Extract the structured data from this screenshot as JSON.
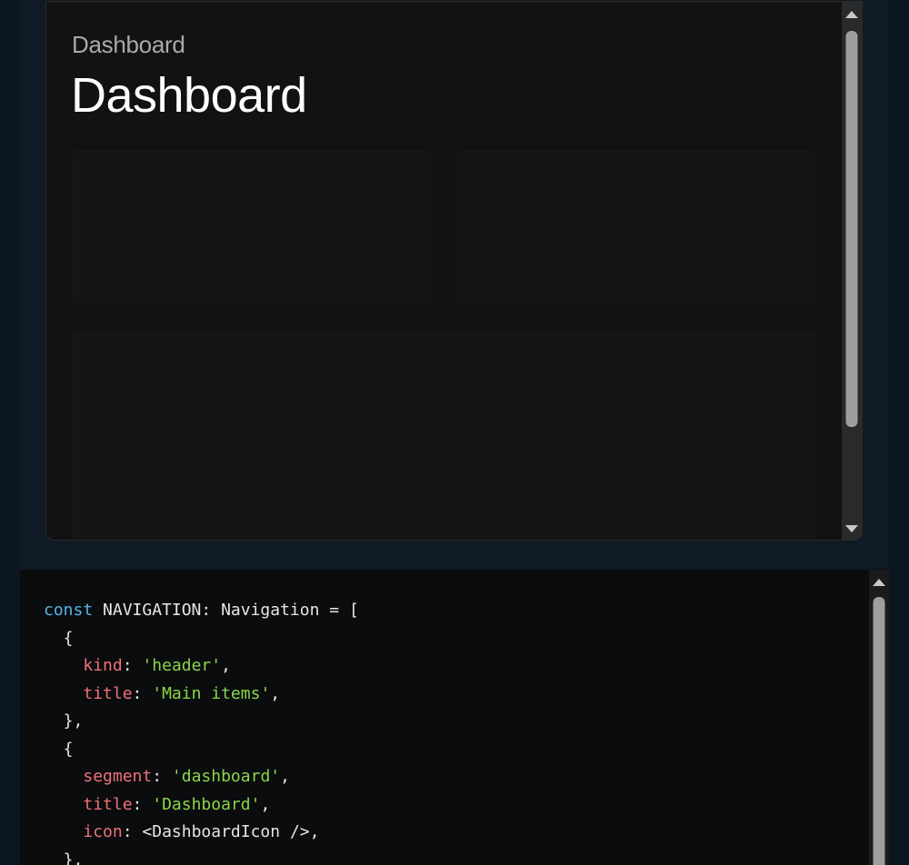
{
  "preview": {
    "breadcrumb": "Dashboard",
    "title": "Dashboard"
  },
  "code": {
    "lines": [
      [
        {
          "t": "kw",
          "v": "const"
        },
        {
          "t": "plain",
          "v": " NAVIGATION: Navigation = ["
        }
      ],
      [
        {
          "t": "plain",
          "v": "  {"
        }
      ],
      [
        {
          "t": "plain",
          "v": "    "
        },
        {
          "t": "prop",
          "v": "kind"
        },
        {
          "t": "plain",
          "v": ": "
        },
        {
          "t": "str",
          "v": "'header'"
        },
        {
          "t": "plain",
          "v": ","
        }
      ],
      [
        {
          "t": "plain",
          "v": "    "
        },
        {
          "t": "prop",
          "v": "title"
        },
        {
          "t": "plain",
          "v": ": "
        },
        {
          "t": "str",
          "v": "'Main items'"
        },
        {
          "t": "plain",
          "v": ","
        }
      ],
      [
        {
          "t": "plain",
          "v": "  },"
        }
      ],
      [
        {
          "t": "plain",
          "v": "  {"
        }
      ],
      [
        {
          "t": "plain",
          "v": "    "
        },
        {
          "t": "prop",
          "v": "segment"
        },
        {
          "t": "plain",
          "v": ": "
        },
        {
          "t": "str",
          "v": "'dashboard'"
        },
        {
          "t": "plain",
          "v": ","
        }
      ],
      [
        {
          "t": "plain",
          "v": "    "
        },
        {
          "t": "prop",
          "v": "title"
        },
        {
          "t": "plain",
          "v": ": "
        },
        {
          "t": "str",
          "v": "'Dashboard'"
        },
        {
          "t": "plain",
          "v": ","
        }
      ],
      [
        {
          "t": "plain",
          "v": "    "
        },
        {
          "t": "prop",
          "v": "icon"
        },
        {
          "t": "plain",
          "v": ": <DashboardIcon />,"
        }
      ],
      [
        {
          "t": "plain",
          "v": "  },"
        }
      ]
    ]
  },
  "colors": {
    "keyword": "#56b6e8",
    "property": "#f07178",
    "string": "#8bd649",
    "text": "#e6e6e6"
  }
}
